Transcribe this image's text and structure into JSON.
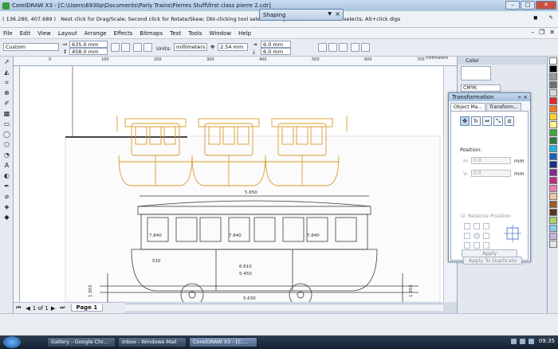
{
  "window": {
    "title": "CorelDRAW X3 - [C:\\Users\\6930p\\Documents\\Parly Trains\\Pierres Stuff\\first class pierre 2.cdr]"
  },
  "status": {
    "coords": "( 136.280, 407.689 )",
    "hint": "Next click for Drag/Scale; Second click for Rotate/Skew; Dbl-clicking tool selects all objects; Shift+click multi-selects; Alt+click digs"
  },
  "shaping_docker": {
    "title": "Shaping"
  },
  "menu": {
    "items": [
      "File",
      "Edit",
      "View",
      "Layout",
      "Arrange",
      "Effects",
      "Bitmaps",
      "Text",
      "Tools",
      "Window",
      "Help"
    ]
  },
  "propbar": {
    "preset": "Custom",
    "width": "635.0 mm",
    "height": "458.0 mm",
    "units_label": "Units:",
    "units": "millimeters",
    "nudge": "2.54 mm",
    "dup_x": "6.0 mm",
    "dup_y": "6.0 mm"
  },
  "ruler": {
    "ticks": [
      "0",
      "100",
      "200",
      "300",
      "400",
      "500",
      "600",
      "700"
    ],
    "unit": "millimeters"
  },
  "pages": {
    "counter": "1 of 1",
    "tab": "Page 1"
  },
  "color_docker": {
    "title": "Color",
    "model": "CMYK"
  },
  "transformation": {
    "title": "Transformation",
    "tabs": [
      "Object Ma...",
      "Transform..."
    ],
    "position_label": "Position:",
    "h_label": "H:",
    "h_value": "0.0",
    "v_label": "V:",
    "v_value": "0.0",
    "unit": "mm",
    "relative_label": "Relative Position",
    "apply_dup": "Apply To Duplicate",
    "apply": "Apply"
  },
  "drawing_dims": [
    "5.650",
    "7.840",
    "7.840",
    "7.840",
    "6.610",
    "5.450",
    "510",
    "5.630",
    "1.955",
    "1.955"
  ],
  "taskbar": {
    "tasks": [
      "Gallery - Google Chr...",
      "Inbox - Windows Mail",
      "CorelDRAW X3 - [C:..."
    ],
    "clock": "09:35"
  },
  "palette_colors": [
    "#ffffff",
    "#000000",
    "#9a9a9a",
    "#6e6e6e",
    "#d7d7d7",
    "#e3262a",
    "#f07a1f",
    "#fbd22c",
    "#fff48d",
    "#40a83a",
    "#2b7a3a",
    "#1fb5d9",
    "#1a5fb8",
    "#1b2f86",
    "#7a2c8f",
    "#c22a7d",
    "#e97fb3",
    "#f2c6a0",
    "#9b5a2a",
    "#5a3418",
    "#a6d46b",
    "#8acbe8",
    "#c7b5dd",
    "#e6e6e6"
  ],
  "colors": {
    "coach_outline": "#d99a2b",
    "drawing_line": "#3a3d46"
  }
}
